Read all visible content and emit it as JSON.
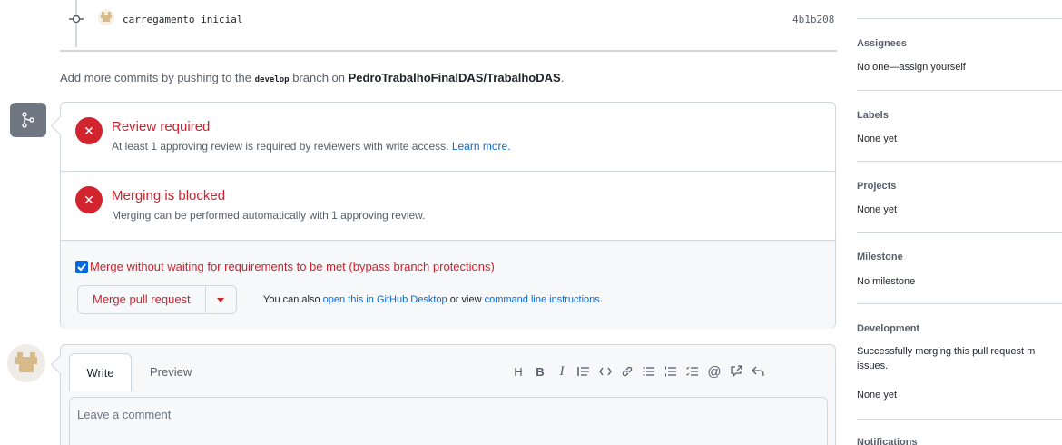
{
  "commit": {
    "message": "carregamento inicial",
    "sha": "4b1b208"
  },
  "push_note": {
    "prefix": "Add more commits by pushing to the",
    "branch": "develop",
    "middle": "branch on",
    "repo": "PedroTrabalhoFinalDAS/TrabalhoDAS",
    "suffix": "."
  },
  "merge": {
    "review_title": "Review required",
    "review_desc": "At least 1 approving review is required by reviewers with write access.",
    "review_link": "Learn more.",
    "blocked_title": "Merging is blocked",
    "blocked_desc": "Merging can be performed automatically with 1 approving review.",
    "bypass_label": "Merge without waiting for requirements to be met (bypass branch protections)",
    "bypass_checked": true,
    "merge_button": "Merge pull request",
    "also_prefix": "You can also",
    "also_link1": "open this in GitHub Desktop",
    "also_middle": "or view",
    "also_link2": "command line instructions",
    "also_suffix": "."
  },
  "comment": {
    "tab_write": "Write",
    "tab_preview": "Preview",
    "placeholder": "Leave a comment",
    "toolbar": [
      "heading-icon",
      "bold-icon",
      "italic-icon",
      "quote-icon",
      "code-icon",
      "link-icon",
      "unordered-list-icon",
      "ordered-list-icon",
      "task-list-icon",
      "mention-icon",
      "reference-icon",
      "reply-icon"
    ]
  },
  "sidebar": {
    "assignees_label": "Assignees",
    "assignees_value": "No one—assign yourself",
    "labels_label": "Labels",
    "labels_value": "None yet",
    "projects_label": "Projects",
    "projects_value": "None yet",
    "milestone_label": "Milestone",
    "milestone_value": "No milestone",
    "development_label": "Development",
    "development_text1": "Successfully merging this pull request m",
    "development_text2": "issues.",
    "development_value": "None yet",
    "notifications_label": "Notifications"
  },
  "colors": {
    "danger": "#cf222e",
    "link": "#0969da",
    "muted": "#57606a"
  }
}
